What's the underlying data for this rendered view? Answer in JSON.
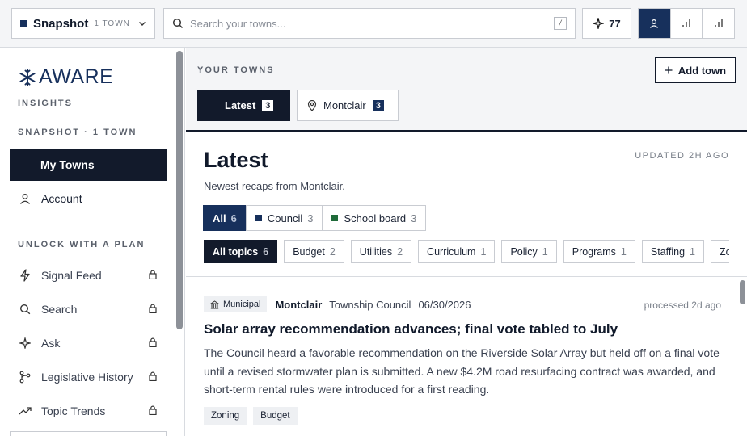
{
  "topbar": {
    "snapshot_label": "Snapshot",
    "snapshot_count": "1 TOWN",
    "search_placeholder": "Search your towns...",
    "search_shortcut": "/",
    "credits": "77"
  },
  "sidebar": {
    "logo_text": "AWARE",
    "subtitle": "INSIGHTS",
    "section_snapshot": "SNAPSHOT · 1 TOWN",
    "items_main": [
      {
        "label": "My Towns"
      },
      {
        "label": "Account"
      }
    ],
    "section_unlock": "UNLOCK WITH A PLAN",
    "items_locked": [
      {
        "label": "Signal Feed"
      },
      {
        "label": "Search"
      },
      {
        "label": "Ask"
      },
      {
        "label": "Legislative History"
      },
      {
        "label": "Topic Trends"
      }
    ]
  },
  "towns": {
    "label": "YOUR TOWNS",
    "add_label": "Add town",
    "tabs": [
      {
        "label": "Latest",
        "count": "3"
      },
      {
        "label": "Montclair",
        "count": "3"
      }
    ]
  },
  "latest": {
    "title": "Latest",
    "updated": "UPDATED 2H AGO",
    "subtitle": "Newest recaps from Montclair.",
    "filters": [
      {
        "label": "All",
        "count": "6"
      },
      {
        "label": "Council",
        "count": "3",
        "color": "#17305c"
      },
      {
        "label": "School board",
        "count": "3",
        "color": "#1f6b3a"
      }
    ],
    "topics": [
      {
        "label": "All topics",
        "count": "6"
      },
      {
        "label": "Budget",
        "count": "2"
      },
      {
        "label": "Utilities",
        "count": "2"
      },
      {
        "label": "Curriculum",
        "count": "1"
      },
      {
        "label": "Policy",
        "count": "1"
      },
      {
        "label": "Programs",
        "count": "1"
      },
      {
        "label": "Staffing",
        "count": "1"
      },
      {
        "label": "Zoning",
        "count": ""
      }
    ]
  },
  "card": {
    "category": "Municipal",
    "town": "Montclair",
    "body": "Township Council",
    "date": "06/30/2026",
    "processed": "processed 2d ago",
    "title": "Solar array recommendation advances; final vote tabled to July",
    "description": "The Council heard a favorable recommendation on the Riverside Solar Array but held off on a final vote until a revised stormwater plan is submitted. A new $4.2M road resurfacing contract was awarded, and short-term rental rules were introduced for a first reading.",
    "tags": [
      "Zoning",
      "Budget"
    ]
  },
  "colors": {
    "navy": "#17305c",
    "dark": "#121a2b",
    "school_board": "#1f6b3a"
  }
}
